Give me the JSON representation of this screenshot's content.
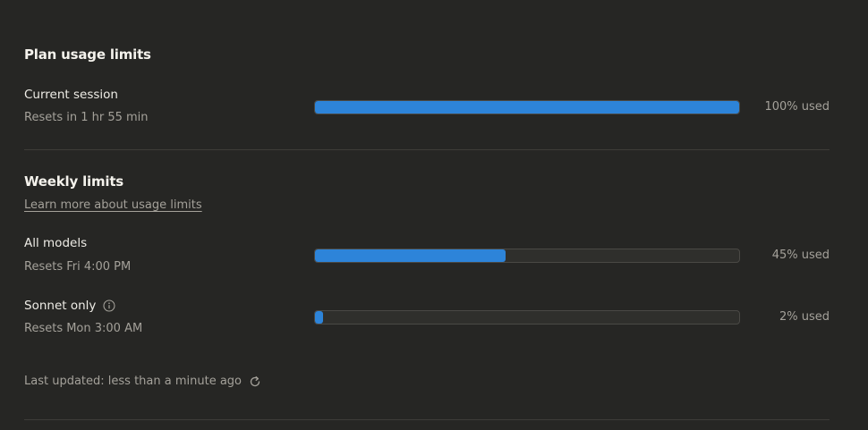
{
  "plan": {
    "title": "Plan usage limits",
    "current_session": {
      "label": "Current session",
      "reset_text": "Resets in 1 hr 55 min",
      "percent_used": 100,
      "percent_text": "100% used"
    }
  },
  "weekly": {
    "title": "Weekly limits",
    "learn_more_link": "Learn more about usage limits",
    "all_models": {
      "label": "All models",
      "reset_text": "Resets Fri 4:00 PM",
      "percent_used": 45,
      "percent_text": "45% used"
    },
    "sonnet_only": {
      "label": "Sonnet only",
      "info_icon": "info-icon",
      "reset_text": "Resets Mon 3:00 AM",
      "percent_used": 2,
      "percent_text": "2% used"
    }
  },
  "footer": {
    "last_updated": "Last updated: less than a minute ago",
    "refresh_icon": "refresh-icon"
  },
  "colors": {
    "background": "#262624",
    "bar_fill": "#2d84d9",
    "bar_track": "#2f2f2c",
    "muted_text": "#a4a19a"
  }
}
